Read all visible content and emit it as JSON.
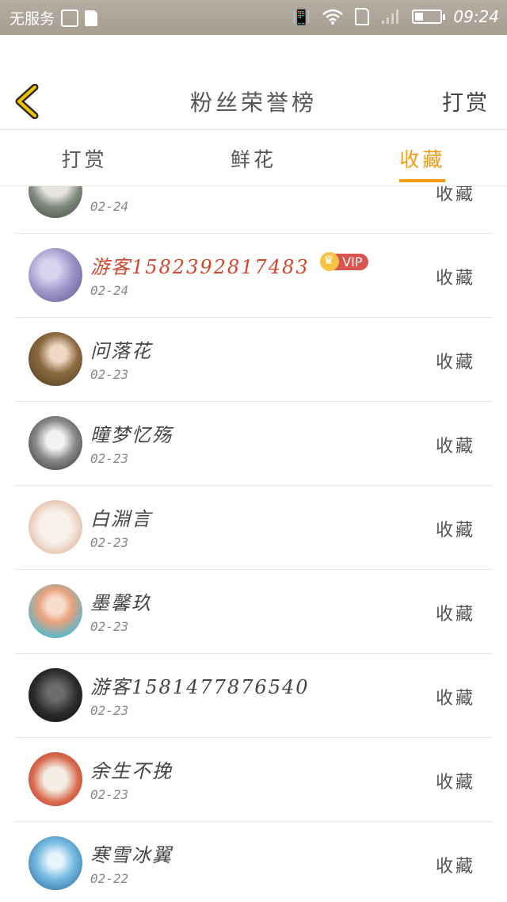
{
  "statusbar": {
    "carrier": "无服务",
    "time": "09:24"
  },
  "header": {
    "title": "粉丝荣誉榜",
    "action": "打赏"
  },
  "tabs": [
    {
      "label": "打赏",
      "active": false
    },
    {
      "label": "鲜花",
      "active": false
    },
    {
      "label": "收藏",
      "active": true
    }
  ],
  "colors": {
    "accent": "#f39c12",
    "vip_name": "#d4452b"
  },
  "fans": [
    {
      "name": "",
      "date": "02-24",
      "action": "收藏",
      "vip": false
    },
    {
      "name": "游客1582392817483",
      "date": "02-24",
      "action": "收藏",
      "vip": true,
      "vip_label": "VIP"
    },
    {
      "name": "问落花",
      "date": "02-23",
      "action": "收藏",
      "vip": false
    },
    {
      "name": "曈梦忆殇",
      "date": "02-23",
      "action": "收藏",
      "vip": false
    },
    {
      "name": "白淵言",
      "date": "02-23",
      "action": "收藏",
      "vip": false
    },
    {
      "name": "墨馨玖",
      "date": "02-23",
      "action": "收藏",
      "vip": false
    },
    {
      "name": "游客1581477876540",
      "date": "02-23",
      "action": "收藏",
      "vip": false
    },
    {
      "name": "余生不挽",
      "date": "02-23",
      "action": "收藏",
      "vip": false
    },
    {
      "name": "寒雪冰翼",
      "date": "02-22",
      "action": "收藏",
      "vip": false
    }
  ]
}
